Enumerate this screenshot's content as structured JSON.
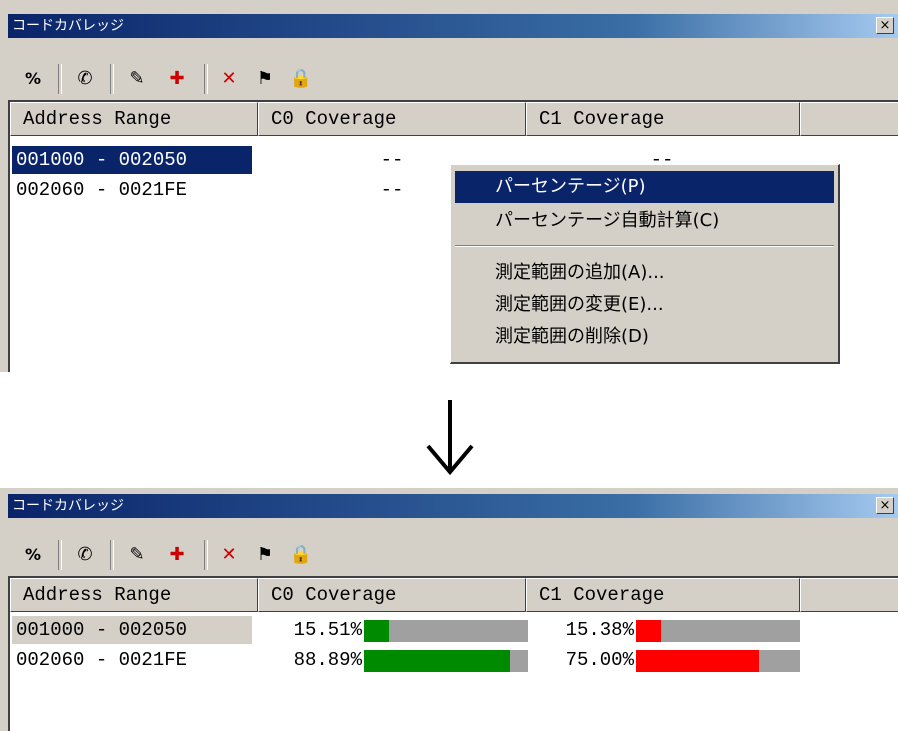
{
  "window_title": "コードカバレッジ",
  "close_glyph": "×",
  "toolbar": [
    "%",
    "✆",
    "✎",
    "✚",
    "✕",
    "⚑",
    "🔒"
  ],
  "columns": [
    "Address Range",
    "C0 Coverage",
    "C1 Coverage"
  ],
  "before": {
    "rows": [
      {
        "address": "001000 - 002050",
        "c0": "--",
        "c1": "--"
      },
      {
        "address": "002060 - 0021FE",
        "c0": "--",
        "c1": ""
      }
    ],
    "context_menu": [
      {
        "label": "パーセンテージ(P)",
        "highlighted": true
      },
      {
        "label": "パーセンテージ自動計算(C)"
      },
      {
        "separator": true
      },
      {
        "label": "測定範囲の追加(A)..."
      },
      {
        "label": "測定範囲の変更(E)..."
      },
      {
        "label": "測定範囲の削除(D)"
      }
    ]
  },
  "after": {
    "rows": [
      {
        "address": "001000 - 002050",
        "c0_pct": "15.51%",
        "c0": 15.51,
        "c1_pct": "15.38%",
        "c1": 15.38
      },
      {
        "address": "002060 - 0021FE",
        "c0_pct": "88.89%",
        "c0": 88.89,
        "c1_pct": "75.00%",
        "c1": 75.0
      }
    ]
  },
  "colors": {
    "c0_bar": "#008a00",
    "c1_bar": "#ff0000",
    "bar_bg": "#a0a0a0"
  }
}
